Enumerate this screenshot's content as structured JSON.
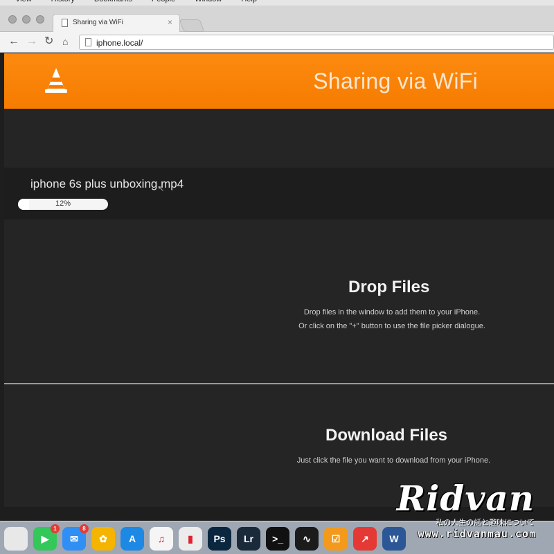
{
  "menubar": {
    "items": [
      "View",
      "History",
      "Bookmarks",
      "People",
      "Window",
      "Help"
    ]
  },
  "browser": {
    "tab_title": "Sharing via WiFi",
    "url": "iphone.local/",
    "icons": {
      "back": "back-arrow-icon",
      "forward": "forward-arrow-icon",
      "reload": "reload-icon",
      "home": "home-icon"
    }
  },
  "header": {
    "title": "Sharing via WiFi",
    "logo": "vlc-cone-icon",
    "accent": "#f88410"
  },
  "upload": {
    "filename": "iphone 6s plus unboxing.mp4",
    "progress_label": "12%",
    "progress_fraction": 0.12
  },
  "drop": {
    "title": "Drop Files",
    "line1": "Drop files in the window to add them to your iPhone.",
    "line2": "Or click on the \"+\" button to use the file picker dialogue."
  },
  "download": {
    "title": "Download Files",
    "line1": "Just click the file you want to download from your iPhone."
  },
  "dock": {
    "apps": [
      {
        "name": "notes",
        "color": "#e8e8e8",
        "glyph": ""
      },
      {
        "name": "facetime",
        "color": "#34c759",
        "glyph": "▶",
        "badge": "1"
      },
      {
        "name": "messages",
        "color": "#2f8ff5",
        "glyph": "✉",
        "badge": "8"
      },
      {
        "name": "photos",
        "color": "#f4b400",
        "glyph": "✿"
      },
      {
        "name": "app-store",
        "color": "#1e88e5",
        "glyph": "A"
      },
      {
        "name": "itunes",
        "color": "#f5f5f5",
        "glyph": "♫"
      },
      {
        "name": "numbers",
        "color": "#ececec",
        "glyph": "▮"
      },
      {
        "name": "photoshop",
        "color": "#0b2740",
        "glyph": "Ps"
      },
      {
        "name": "lightroom",
        "color": "#1a2a3a",
        "glyph": "Lr"
      },
      {
        "name": "terminal",
        "color": "#111111",
        "glyph": ">_"
      },
      {
        "name": "activity-monitor",
        "color": "#1b1b1b",
        "glyph": "∿"
      },
      {
        "name": "todo",
        "color": "#f39a1c",
        "glyph": "☑"
      },
      {
        "name": "stocks",
        "color": "#e53935",
        "glyph": "↗"
      },
      {
        "name": "word",
        "color": "#2b5797",
        "glyph": "W"
      }
    ]
  },
  "watermark": {
    "signature": "Ridvan",
    "tagline": "私の人生の話と趣味について",
    "url": "www.ridvanmau.com"
  }
}
